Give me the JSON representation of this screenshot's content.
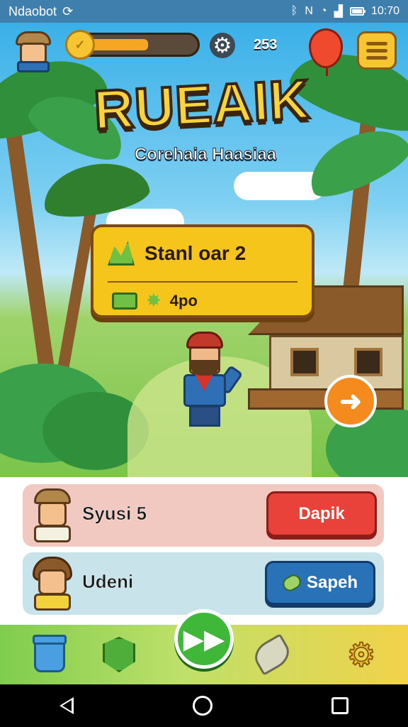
{
  "status_bar": {
    "carrier": "Ndaobot",
    "carrier_icon": "sync-icon",
    "time": "10:70",
    "icons": [
      "bluetooth-icon",
      "no-signal-icon",
      "wifi-icon",
      "signal-icon",
      "battery-icon"
    ]
  },
  "hud": {
    "xp_progress": 0.45,
    "count": "253",
    "coin_icon": "coin-icon",
    "gear_icon": "gear-icon",
    "balloon_icon": "balloon-icon",
    "menu_icon": "hamburger-menu-icon"
  },
  "game": {
    "title": "RUEAIK",
    "subtitle": "Corehaia Haasiaa"
  },
  "stage_panel": {
    "label": "Stanl oar 2",
    "reward": "4po",
    "icons": [
      "map-icon",
      "ticket-icon",
      "star-icon"
    ]
  },
  "next_button": {
    "icon": "arrow-right-icon"
  },
  "cards": [
    {
      "label": "Syusi 5",
      "button_label": "Dapik",
      "color": "#f2c9c0",
      "button_color": "#e8423a"
    },
    {
      "label": "Udeni",
      "button_label": "Sapeh",
      "color": "#c9e3ea",
      "button_color": "#2a72b8"
    }
  ],
  "bottom_nav": {
    "items": [
      "trash-icon",
      "shield-icon",
      "fast-forward-icon",
      "leaf-icon",
      "settings-gear-icon"
    ]
  },
  "colors": {
    "status_bar": "#3f7fae",
    "title_yellow": "#f7d43a",
    "panel_yellow": "#f5c51b",
    "play_green": "#3fb83a",
    "next_orange": "#f58b1f"
  }
}
